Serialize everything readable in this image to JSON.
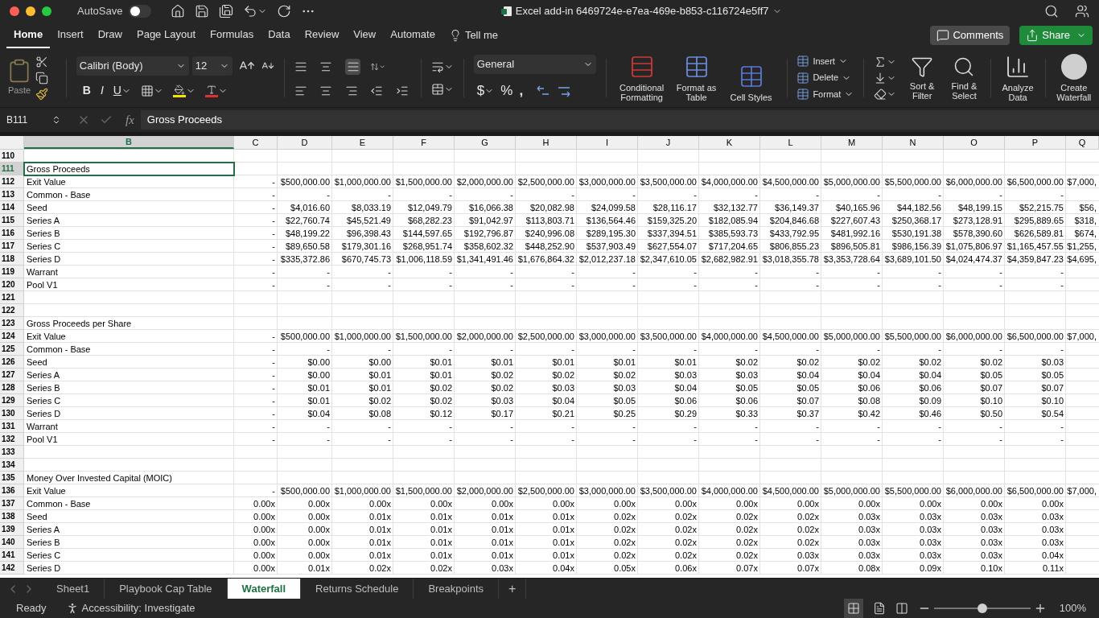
{
  "titlebar": {
    "autosave": {
      "label": "AutoSave",
      "on": false
    },
    "title": "Excel add-in 6469724e-e7ea-469e-b853-c116724e5ff7"
  },
  "tabs": [
    {
      "label": "Home",
      "selected": true
    },
    {
      "label": "Insert",
      "selected": false
    },
    {
      "label": "Draw",
      "selected": false
    },
    {
      "label": "Page Layout",
      "selected": false
    },
    {
      "label": "Formulas",
      "selected": false
    },
    {
      "label": "Data",
      "selected": false
    },
    {
      "label": "Review",
      "selected": false
    },
    {
      "label": "View",
      "selected": false
    },
    {
      "label": "Automate",
      "selected": false
    }
  ],
  "tell_me": "Tell me",
  "comments": "Comments",
  "share": "Share",
  "ribbon": {
    "paste": "Paste",
    "font": "Calibri (Body)",
    "size": "12",
    "bold": "B",
    "italic": "I",
    "underline": "U",
    "number_format": "General",
    "currency": "$",
    "percent": "%",
    "comma": ",",
    "styles": [
      {
        "kind": "conditional",
        "label": "Conditional Formatting"
      },
      {
        "kind": "table",
        "label": "Format as Table"
      },
      {
        "kind": "cellstyles",
        "label": "Cell Styles"
      }
    ],
    "cells": [
      "Insert",
      "Delete",
      "Format"
    ],
    "editing": [
      {
        "kind": "sort",
        "label": "Sort & Filter"
      },
      {
        "kind": "find",
        "label": "Find & Select"
      }
    ],
    "analyze": "Analyze Data",
    "waterfall": "Create Waterfall"
  },
  "formula_bar": {
    "name_box": "B111",
    "function_label": "fx",
    "formula": "Gross Proceeds"
  },
  "columns": [
    {
      "label": "B",
      "selected": true
    },
    {
      "label": "C",
      "selected": false
    },
    {
      "label": "D",
      "selected": false
    },
    {
      "label": "E",
      "selected": false
    },
    {
      "label": "F",
      "selected": false
    },
    {
      "label": "G",
      "selected": false
    },
    {
      "label": "H",
      "selected": false
    },
    {
      "label": "I",
      "selected": false
    },
    {
      "label": "J",
      "selected": false
    },
    {
      "label": "K",
      "selected": false
    },
    {
      "label": "L",
      "selected": false
    },
    {
      "label": "M",
      "selected": false
    },
    {
      "label": "N",
      "selected": false
    },
    {
      "label": "O",
      "selected": false
    },
    {
      "label": "P",
      "selected": false
    },
    {
      "label": "Q",
      "selected": false
    }
  ],
  "rows": [
    {
      "num": "110",
      "selected": false
    },
    {
      "num": "111",
      "selected": true,
      "label": "Gross Proceeds"
    },
    {
      "num": "112",
      "selected": false,
      "label": "Exit Value",
      "c": "-",
      "values": [
        "$500,000.00",
        "$1,000,000.00",
        "$1,500,000.00",
        "$2,000,000.00",
        "$2,500,000.00",
        "$3,000,000.00",
        "$3,500,000.00",
        "$4,000,000.00",
        "$4,500,000.00",
        "$5,000,000.00",
        "$5,500,000.00",
        "$6,000,000.00",
        "$6,500,000.00"
      ],
      "q": "$7,000,"
    },
    {
      "num": "113",
      "selected": false,
      "label": "Common - Base",
      "c": "-",
      "values": [
        "-",
        "-",
        "-",
        "-",
        "-",
        "-",
        "-",
        "-",
        "-",
        "-",
        "-",
        "-",
        "-"
      ]
    },
    {
      "num": "114",
      "selected": false,
      "label": "Seed",
      "c": "-",
      "values": [
        "$4,016.60",
        "$8,033.19",
        "$12,049.79",
        "$16,066.38",
        "$20,082.98",
        "$24,099.58",
        "$28,116.17",
        "$32,132.77",
        "$36,149.37",
        "$40,165.96",
        "$44,182.56",
        "$48,199.15",
        "$52,215.75"
      ],
      "q": "$56,"
    },
    {
      "num": "115",
      "selected": false,
      "label": "Series A",
      "c": "-",
      "values": [
        "$22,760.74",
        "$45,521.49",
        "$68,282.23",
        "$91,042.97",
        "$113,803.71",
        "$136,564.46",
        "$159,325.20",
        "$182,085.94",
        "$204,846.68",
        "$227,607.43",
        "$250,368.17",
        "$273,128.91",
        "$295,889.65"
      ],
      "q": "$318,"
    },
    {
      "num": "116",
      "selected": false,
      "label": "Series B",
      "c": "-",
      "values": [
        "$48,199.22",
        "$96,398.43",
        "$144,597.65",
        "$192,796.87",
        "$240,996.08",
        "$289,195.30",
        "$337,394.51",
        "$385,593.73",
        "$433,792.95",
        "$481,992.16",
        "$530,191.38",
        "$578,390.60",
        "$626,589.81"
      ],
      "q": "$674,"
    },
    {
      "num": "117",
      "selected": false,
      "label": "Series C",
      "c": "-",
      "values": [
        "$89,650.58",
        "$179,301.16",
        "$268,951.74",
        "$358,602.32",
        "$448,252.90",
        "$537,903.49",
        "$627,554.07",
        "$717,204.65",
        "$806,855.23",
        "$896,505.81",
        "$986,156.39",
        "$1,075,806.97",
        "$1,165,457.55"
      ],
      "q": "$1,255,"
    },
    {
      "num": "118",
      "selected": false,
      "label": "Series D",
      "c": "-",
      "values": [
        "$335,372.86",
        "$670,745.73",
        "$1,006,118.59",
        "$1,341,491.46",
        "$1,676,864.32",
        "$2,012,237.18",
        "$2,347,610.05",
        "$2,682,982.91",
        "$3,018,355.78",
        "$3,353,728.64",
        "$3,689,101.50",
        "$4,024,474.37",
        "$4,359,847.23"
      ],
      "q": "$4,695,"
    },
    {
      "num": "119",
      "selected": false,
      "label": "Warrant",
      "c": "-",
      "values": [
        "-",
        "-",
        "-",
        "-",
        "-",
        "-",
        "-",
        "-",
        "-",
        "-",
        "-",
        "-",
        "-"
      ]
    },
    {
      "num": "120",
      "selected": false,
      "label": "Pool V1",
      "c": "-",
      "values": [
        "-",
        "-",
        "-",
        "-",
        "-",
        "-",
        "-",
        "-",
        "-",
        "-",
        "-",
        "-",
        "-"
      ]
    },
    {
      "num": "121",
      "selected": false
    },
    {
      "num": "122",
      "selected": false
    },
    {
      "num": "123",
      "selected": false,
      "label": "Gross Proceeds per Share"
    },
    {
      "num": "124",
      "selected": false,
      "label": "Exit Value",
      "c": "-",
      "values": [
        "$500,000.00",
        "$1,000,000.00",
        "$1,500,000.00",
        "$2,000,000.00",
        "$2,500,000.00",
        "$3,000,000.00",
        "$3,500,000.00",
        "$4,000,000.00",
        "$4,500,000.00",
        "$5,000,000.00",
        "$5,500,000.00",
        "$6,000,000.00",
        "$6,500,000.00"
      ],
      "q": "$7,000,"
    },
    {
      "num": "125",
      "selected": false,
      "label": "Common - Base",
      "c": "-",
      "values": [
        "-",
        "-",
        "-",
        "-",
        "-",
        "-",
        "-",
        "-",
        "-",
        "-",
        "-",
        "-",
        "-"
      ]
    },
    {
      "num": "126",
      "selected": false,
      "label": "Seed",
      "c": "-",
      "values": [
        "$0.00",
        "$0.00",
        "$0.01",
        "$0.01",
        "$0.01",
        "$0.01",
        "$0.01",
        "$0.02",
        "$0.02",
        "$0.02",
        "$0.02",
        "$0.02",
        "$0.03"
      ]
    },
    {
      "num": "127",
      "selected": false,
      "label": "Series A",
      "c": "-",
      "values": [
        "$0.00",
        "$0.01",
        "$0.01",
        "$0.02",
        "$0.02",
        "$0.02",
        "$0.03",
        "$0.03",
        "$0.04",
        "$0.04",
        "$0.04",
        "$0.05",
        "$0.05"
      ]
    },
    {
      "num": "128",
      "selected": false,
      "label": "Series B",
      "c": "-",
      "values": [
        "$0.01",
        "$0.01",
        "$0.02",
        "$0.02",
        "$0.03",
        "$0.03",
        "$0.04",
        "$0.05",
        "$0.05",
        "$0.06",
        "$0.06",
        "$0.07",
        "$0.07"
      ]
    },
    {
      "num": "129",
      "selected": false,
      "label": "Series C",
      "c": "-",
      "values": [
        "$0.01",
        "$0.02",
        "$0.02",
        "$0.03",
        "$0.04",
        "$0.05",
        "$0.06",
        "$0.06",
        "$0.07",
        "$0.08",
        "$0.09",
        "$0.10",
        "$0.10"
      ]
    },
    {
      "num": "130",
      "selected": false,
      "label": "Series D",
      "c": "-",
      "values": [
        "$0.04",
        "$0.08",
        "$0.12",
        "$0.17",
        "$0.21",
        "$0.25",
        "$0.29",
        "$0.33",
        "$0.37",
        "$0.42",
        "$0.46",
        "$0.50",
        "$0.54"
      ]
    },
    {
      "num": "131",
      "selected": false,
      "label": "Warrant",
      "c": "-",
      "values": [
        "-",
        "-",
        "-",
        "-",
        "-",
        "-",
        "-",
        "-",
        "-",
        "-",
        "-",
        "-",
        "-"
      ]
    },
    {
      "num": "132",
      "selected": false,
      "label": "Pool V1",
      "c": "-",
      "values": [
        "-",
        "-",
        "-",
        "-",
        "-",
        "-",
        "-",
        "-",
        "-",
        "-",
        "-",
        "-",
        "-"
      ]
    },
    {
      "num": "133",
      "selected": false
    },
    {
      "num": "134",
      "selected": false
    },
    {
      "num": "135",
      "selected": false,
      "label": "Money Over Invested Capital (MOIC)"
    },
    {
      "num": "136",
      "selected": false,
      "label": "Exit Value",
      "c": "-",
      "values": [
        "$500,000.00",
        "$1,000,000.00",
        "$1,500,000.00",
        "$2,000,000.00",
        "$2,500,000.00",
        "$3,000,000.00",
        "$3,500,000.00",
        "$4,000,000.00",
        "$4,500,000.00",
        "$5,000,000.00",
        "$5,500,000.00",
        "$6,000,000.00",
        "$6,500,000.00"
      ],
      "q": "$7,000,"
    },
    {
      "num": "137",
      "selected": false,
      "label": "Common - Base",
      "c": "0.00x",
      "values": [
        "0.00x",
        "0.00x",
        "0.00x",
        "0.00x",
        "0.00x",
        "0.00x",
        "0.00x",
        "0.00x",
        "0.00x",
        "0.00x",
        "0.00x",
        "0.00x",
        "0.00x"
      ]
    },
    {
      "num": "138",
      "selected": false,
      "label": "Seed",
      "c": "0.00x",
      "values": [
        "0.00x",
        "0.01x",
        "0.01x",
        "0.01x",
        "0.01x",
        "0.02x",
        "0.02x",
        "0.02x",
        "0.02x",
        "0.03x",
        "0.03x",
        "0.03x",
        "0.03x"
      ]
    },
    {
      "num": "139",
      "selected": false,
      "label": "Series A",
      "c": "0.00x",
      "values": [
        "0.00x",
        "0.01x",
        "0.01x",
        "0.01x",
        "0.01x",
        "0.02x",
        "0.02x",
        "0.02x",
        "0.02x",
        "0.03x",
        "0.03x",
        "0.03x",
        "0.03x"
      ]
    },
    {
      "num": "140",
      "selected": false,
      "label": "Series B",
      "c": "0.00x",
      "values": [
        "0.00x",
        "0.01x",
        "0.01x",
        "0.01x",
        "0.01x",
        "0.02x",
        "0.02x",
        "0.02x",
        "0.02x",
        "0.03x",
        "0.03x",
        "0.03x",
        "0.03x"
      ]
    },
    {
      "num": "141",
      "selected": false,
      "label": "Series C",
      "c": "0.00x",
      "values": [
        "0.00x",
        "0.01x",
        "0.01x",
        "0.01x",
        "0.01x",
        "0.02x",
        "0.02x",
        "0.02x",
        "0.03x",
        "0.03x",
        "0.03x",
        "0.03x",
        "0.04x"
      ]
    },
    {
      "num": "142",
      "selected": false,
      "label": "Series D",
      "c": "0.00x",
      "values": [
        "0.01x",
        "0.02x",
        "0.02x",
        "0.03x",
        "0.04x",
        "0.05x",
        "0.06x",
        "0.07x",
        "0.07x",
        "0.08x",
        "0.09x",
        "0.10x",
        "0.11x"
      ]
    }
  ],
  "sheets": [
    {
      "label": "Sheet1",
      "selected": false
    },
    {
      "label": "Playbook Cap Table",
      "selected": false
    },
    {
      "label": "Waterfall",
      "selected": true
    },
    {
      "label": "Returns Schedule",
      "selected": false
    },
    {
      "label": "Breakpoints",
      "selected": false
    }
  ],
  "add_sheet": "+",
  "status": {
    "ready": "Ready",
    "accessibility": "Accessibility: Investigate",
    "zoom": {
      "level": 0.5
    },
    "zoom_label": "100%"
  }
}
